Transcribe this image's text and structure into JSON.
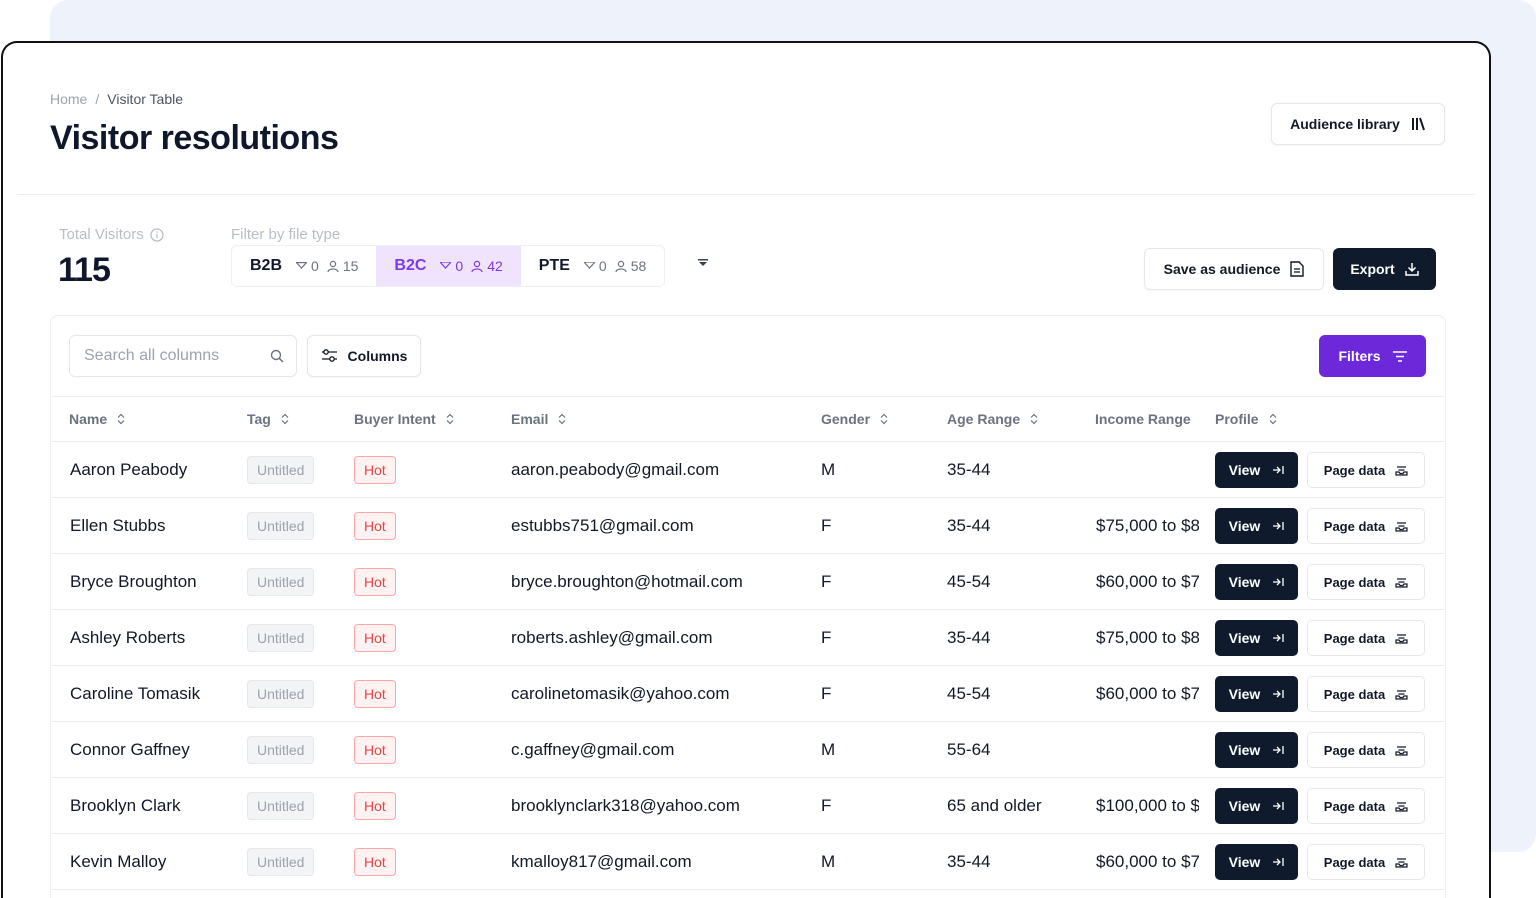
{
  "breadcrumb": {
    "home": "Home",
    "separator": "/",
    "current": "Visitor Table"
  },
  "page_title": "Visitor resolutions",
  "audience_library_label": "Audience library",
  "total_visitors": {
    "label": "Total Visitors",
    "value": "115"
  },
  "filter_by_file_type_label": "Filter by file type",
  "file_types": [
    {
      "code": "B2B",
      "filters": "0",
      "people": "15",
      "active": false
    },
    {
      "code": "B2C",
      "filters": "0",
      "people": "42",
      "active": true
    },
    {
      "code": "PTE",
      "filters": "0",
      "people": "58",
      "active": false
    }
  ],
  "save_audience_label": "Save as audience",
  "export_label": "Export",
  "search": {
    "placeholder": "Search all columns"
  },
  "columns_label": "Columns",
  "filters_label": "Filters",
  "colors": {
    "primary_dark": "#0f1b2d",
    "accent_purple": "#6d28d9",
    "active_segment_bg": "#efe3fd",
    "hot_red": "#ef4444"
  },
  "table": {
    "headers": [
      "Name",
      "Tag",
      "Buyer Intent",
      "Email",
      "Gender",
      "Age Range",
      "Income Range",
      "Profile"
    ],
    "rows": [
      {
        "name": "Aaron Peabody",
        "tag": "Untitled",
        "intent": "Hot",
        "email": "aaron.peabody@gmail.com",
        "gender": "M",
        "age": "35-44",
        "income": ""
      },
      {
        "name": "Ellen Stubbs",
        "tag": "Untitled",
        "intent": "Hot",
        "email": "estubbs751@gmail.com",
        "gender": "F",
        "age": "35-44",
        "income": "$75,000 to $8"
      },
      {
        "name": "Bryce Broughton",
        "tag": "Untitled",
        "intent": "Hot",
        "email": "bryce.broughton@hotmail.com",
        "gender": "F",
        "age": "45-54",
        "income": "$60,000 to $7"
      },
      {
        "name": "Ashley Roberts",
        "tag": "Untitled",
        "intent": "Hot",
        "email": "roberts.ashley@gmail.com",
        "gender": "F",
        "age": "35-44",
        "income": "$75,000 to $8"
      },
      {
        "name": "Caroline Tomasik",
        "tag": "Untitled",
        "intent": "Hot",
        "email": "carolinetomasik@yahoo.com",
        "gender": "F",
        "age": "45-54",
        "income": "$60,000 to $7"
      },
      {
        "name": "Connor Gaffney",
        "tag": "Untitled",
        "intent": "Hot",
        "email": "c.gaffney@gmail.com",
        "gender": "M",
        "age": "55-64",
        "income": ""
      },
      {
        "name": "Brooklyn Clark",
        "tag": "Untitled",
        "intent": "Hot",
        "email": "brooklynclark318@yahoo.com",
        "gender": "F",
        "age": "65 and older",
        "income": "$100,000 to $"
      },
      {
        "name": "Kevin Malloy",
        "tag": "Untitled",
        "intent": "Hot",
        "email": "kmalloy817@gmail.com",
        "gender": "M",
        "age": "35-44",
        "income": "$60,000 to $7"
      }
    ],
    "view_label": "View",
    "page_data_label": "Page data"
  }
}
